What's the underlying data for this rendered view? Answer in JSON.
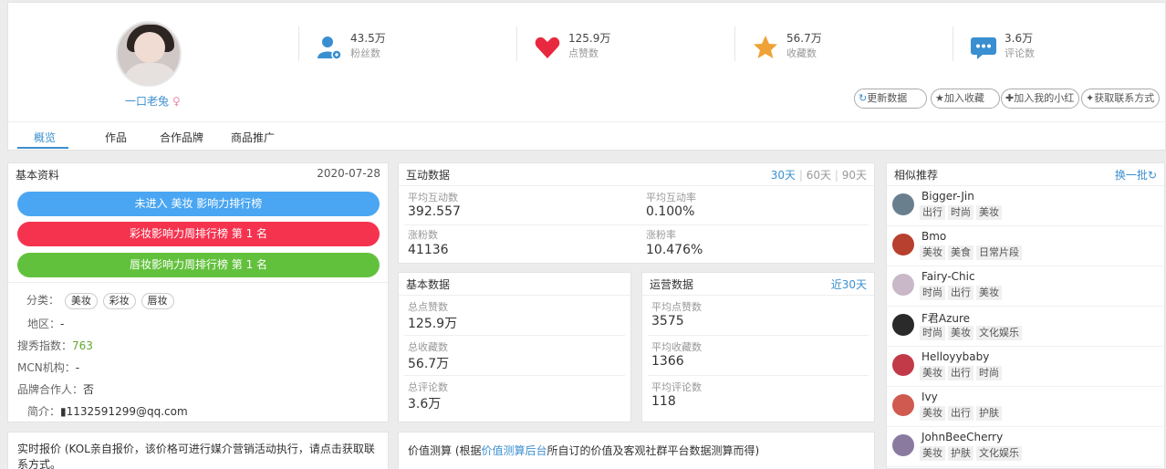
{
  "profile": {
    "name": "一口老兔",
    "gender_symbol": "♀"
  },
  "stats": [
    {
      "value": "43.5万",
      "label": "粉丝数",
      "icon": "user-icon"
    },
    {
      "value": "125.9万",
      "label": "点赞数",
      "icon": "heart-icon"
    },
    {
      "value": "56.7万",
      "label": "收藏数",
      "icon": "star-icon"
    },
    {
      "value": "3.6万",
      "label": "评论数",
      "icon": "comment-icon"
    }
  ],
  "actions": {
    "refresh": "更新数据",
    "favorite": "加入收藏",
    "add_list": "加入我的小红",
    "contact": "获取联系方式"
  },
  "tabs": [
    "概览",
    "作品",
    "合作品牌",
    "商品推广"
  ],
  "basic_info": {
    "title": "基本资料",
    "date": "2020-07-28",
    "ranks": [
      {
        "text": "未进入 美妆 影响力排行榜",
        "color": "#4aa6f2"
      },
      {
        "text": "彩妆影响力周排行榜 第 1 名",
        "color": "#f5334f"
      },
      {
        "text": "唇妆影响力周排行榜 第 1 名",
        "color": "#62c13c"
      }
    ],
    "category_label": "分类：",
    "categories": [
      "美妆",
      "彩妆",
      "唇妆"
    ],
    "region_label": "地区：",
    "region": "-",
    "index_label": "搜秀指数：",
    "index": "763",
    "mcn_label": "MCN机构：",
    "mcn": "-",
    "brand_label": "品牌合作人：",
    "brand": "否",
    "intro_label": "简介：",
    "intro": "1132591299@qq.com"
  },
  "interaction": {
    "title": "互动数据",
    "ranges": [
      "30天",
      "60天",
      "90天"
    ],
    "metrics": [
      {
        "label": "平均互动数",
        "value": "392.557"
      },
      {
        "label": "平均互动率",
        "value": "0.100%"
      },
      {
        "label": "涨粉数",
        "value": "41136"
      },
      {
        "label": "涨粉率",
        "value": "10.476%"
      }
    ]
  },
  "basic_data": {
    "title": "基本数据",
    "metrics": [
      {
        "label": "总点赞数",
        "value": "125.9万"
      },
      {
        "label": "总收藏数",
        "value": "56.7万"
      },
      {
        "label": "总评论数",
        "value": "3.6万"
      }
    ]
  },
  "ops_data": {
    "title": "运营数据",
    "range": "近30天",
    "metrics": [
      {
        "label": "平均点赞数",
        "value": "3575"
      },
      {
        "label": "平均收藏数",
        "value": "1366"
      },
      {
        "label": "平均评论数",
        "value": "118"
      }
    ]
  },
  "similar": {
    "title": "相似推荐",
    "refresh": "换一批",
    "items": [
      {
        "name": "Bigger-Jin",
        "tags": [
          "出行",
          "时尚",
          "美妆"
        ],
        "color": "#6a7f8e"
      },
      {
        "name": "Bmo",
        "tags": [
          "美妆",
          "美食",
          "日常片段"
        ],
        "color": "#b8402e"
      },
      {
        "name": "Fairy-Chic",
        "tags": [
          "时尚",
          "出行",
          "美妆"
        ],
        "color": "#c9b8c8"
      },
      {
        "name": "F君Azure",
        "tags": [
          "时尚",
          "美妆",
          "文化娱乐"
        ],
        "color": "#2a2a2a"
      },
      {
        "name": "Helloyybaby",
        "tags": [
          "美妆",
          "出行",
          "时尚"
        ],
        "color": "#c23a48"
      },
      {
        "name": "Ivy",
        "tags": [
          "美妆",
          "出行",
          "护肤"
        ],
        "color": "#d05a50"
      },
      {
        "name": "JohnBeeCherry",
        "tags": [
          "美妆",
          "护肤",
          "文化娱乐"
        ],
        "color": "#8a7aa0"
      }
    ]
  },
  "quote": {
    "text": "实时报价 (KOL亲自报价，该价格可进行媒介营销活动执行，请点击获取联系方式。"
  },
  "value_calc": {
    "prefix": "价值测算 (根据",
    "link": "价值测算后台",
    "suffix": "所自订的价值及客观社群平台数据测算而得)"
  }
}
